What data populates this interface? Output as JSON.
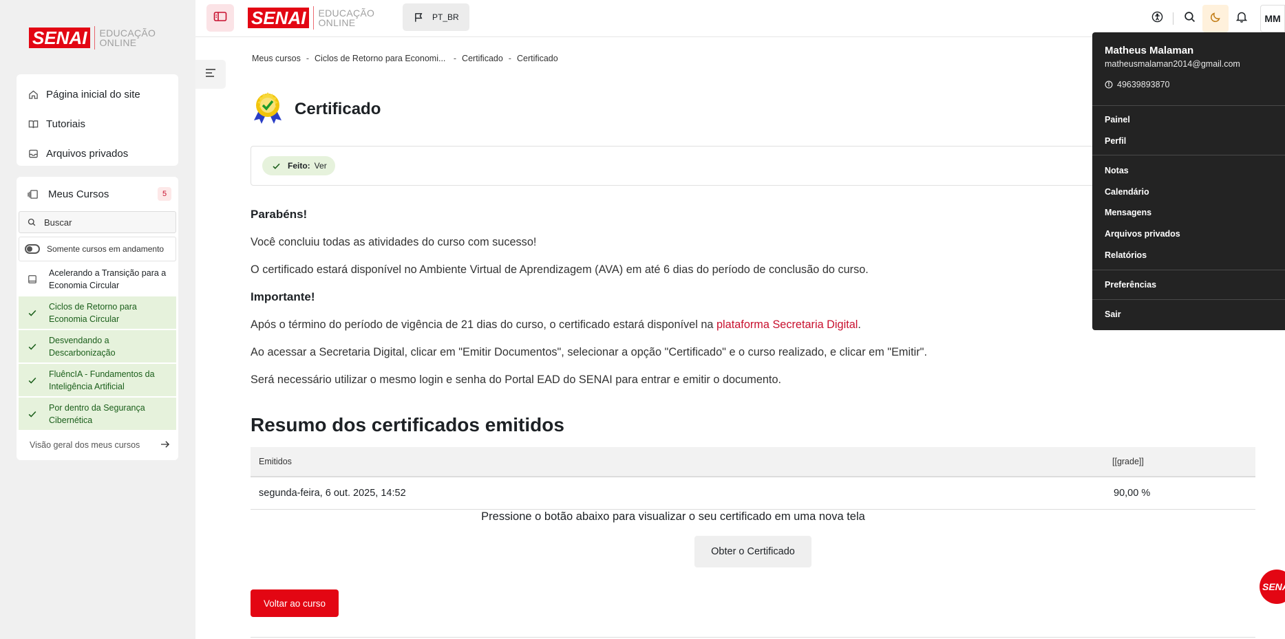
{
  "brand": {
    "logo_text": "SENAI",
    "logo_sub_1": "EDUCAÇÃO",
    "logo_sub_2": "ONLINE",
    "accent": "#e30613"
  },
  "sidebar": {
    "nav": [
      {
        "label": "Página inicial do site",
        "icon": "home-icon"
      },
      {
        "label": "Tutoriais",
        "icon": "book-open-icon"
      },
      {
        "label": "Arquivos privados",
        "icon": "inbox-icon"
      }
    ],
    "courses_title": "Meus Cursos",
    "courses_count": "5",
    "search_label": "Buscar",
    "toggle_label": "Somente cursos em andamento",
    "courses": [
      {
        "line1": "Acelerando a Transição para a",
        "line2": "Economia Circular",
        "done": false
      },
      {
        "line1": "Ciclos de Retorno para",
        "line2": "Economia Circular",
        "done": true
      },
      {
        "line1": "Desvendando a",
        "line2": "Descarbonização",
        "done": true
      },
      {
        "line1": "FluêncIA - Fundamentos da",
        "line2": "Inteligência Artificial",
        "done": true
      },
      {
        "line1": "Por dentro da Segurança",
        "line2": "Cibernética",
        "done": true
      }
    ],
    "overview_link": "Visão geral dos meus cursos"
  },
  "topbar": {
    "language": "PT_BR",
    "avatar_initials": "MM"
  },
  "breadcrumb": [
    "Meus cursos",
    "Ciclos de Retorno para Economi...",
    "Certificado",
    "Certificado"
  ],
  "page": {
    "title": "Certificado",
    "done_label": "Feito:",
    "done_value": "Ver"
  },
  "content": {
    "congrats": "Parabéns!",
    "p1": "Você concluiu todas as atividades do curso com sucesso!",
    "p2": "O certificado estará disponível no Ambiente Virtual de Aprendizagem (AVA) em até 6 dias do período de conclusão do curso.",
    "important": "Importante!",
    "p3_before": "Após o término do período de vigência de 21 dias do curso, o certificado estará disponível na ",
    "p3_link": "plataforma Secretaria Digital",
    "p3_after": ".",
    "p4": "Ao acessar a Secretaria Digital, clicar em \"Emitir Documentos\", selecionar a opção \"Certificado\" e o curso realizado, e clicar em \"Emitir\".",
    "p5": "Será necessário utilizar o mesmo login e senha do Portal EAD do SENAI para entrar e emitir o documento."
  },
  "summary": {
    "title": "Resumo dos certificados emitidos",
    "headers": [
      "Emitidos",
      "[[grade]]"
    ],
    "rows": [
      {
        "date": "segunda-feira, 6 out. 2025, 14:52",
        "grade": "90,00 %"
      }
    ],
    "press_text": "Pressione o botão abaixo para visualizar o seu certificado em uma nova tela",
    "get_button": "Obter o Certificado",
    "back_button": "Voltar ao curso"
  },
  "user_menu": {
    "name": "Matheus Malaman",
    "email": "matheusmalaman2014@gmail.com",
    "id": "49639893870",
    "items_group1": [
      "Painel",
      "Perfil"
    ],
    "items_group2": [
      "Notas",
      "Calendário",
      "Mensagens",
      "Arquivos privados",
      "Relatórios"
    ],
    "items_group3": [
      "Preferências"
    ],
    "items_group4": [
      "Sair"
    ]
  },
  "floating_bubble": "SENAI"
}
